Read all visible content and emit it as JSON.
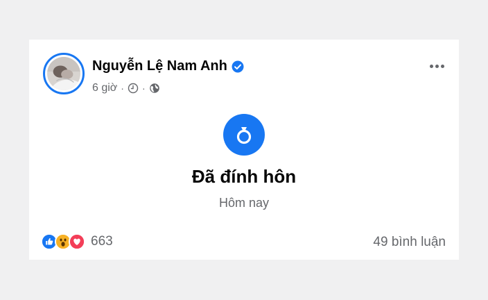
{
  "post": {
    "author": "Nguyễn Lệ Nam Anh",
    "time": "6 giờ",
    "separator": "·",
    "event_title": "Đã đính hôn",
    "event_date": "Hôm nay",
    "reaction_count": "663",
    "comments": "49 bình luận"
  },
  "icons": {
    "verified": "verified-badge-icon",
    "clock": "clock-icon",
    "globe": "globe-icon",
    "more": "more-options-icon",
    "event": "ring-icon",
    "reactions": [
      "like-icon",
      "wow-icon",
      "love-icon"
    ]
  },
  "colors": {
    "accent": "#1877f2",
    "love": "#f33e58",
    "wow": "#f7b125",
    "text_primary": "#050505",
    "text_secondary": "#65676b",
    "background": "#f0f0f1",
    "card": "#ffffff"
  }
}
